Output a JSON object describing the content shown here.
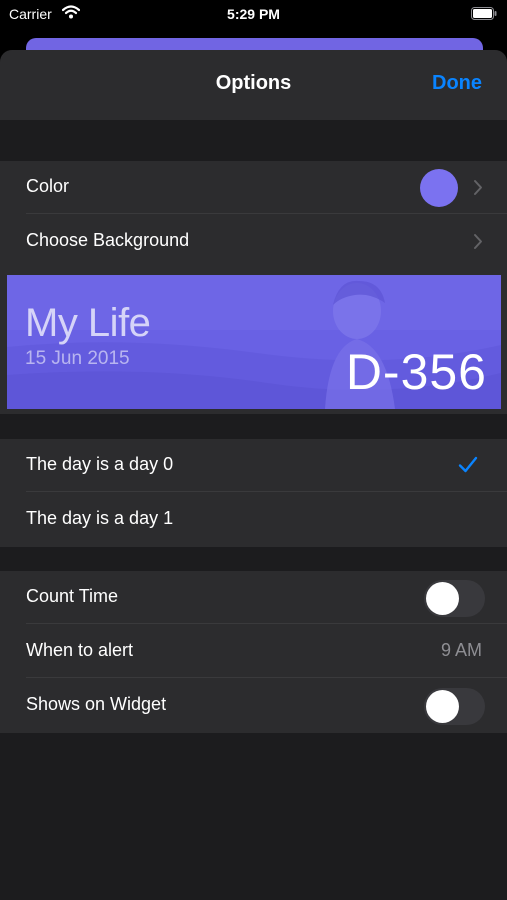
{
  "status_bar": {
    "carrier": "Carrier",
    "time": "5:29 PM",
    "icons": [
      "wifi-icon",
      "battery-icon"
    ]
  },
  "nav": {
    "title": "Options",
    "done_label": "Done"
  },
  "appearance": {
    "color_label": "Color",
    "color_value": "#7b72f0",
    "background_label": "Choose Background"
  },
  "preview": {
    "title": "My Life",
    "date": "15 Jun 2015",
    "count": "D-356",
    "accent": "#6a62e6"
  },
  "day_options": [
    {
      "label": "The day is a day 0",
      "selected": true
    },
    {
      "label": "The day is a day 1",
      "selected": false
    }
  ],
  "settings": {
    "count_time_label": "Count Time",
    "count_time_on": false,
    "alert_label": "When to alert",
    "alert_value": "9 AM",
    "widget_label": "Shows on Widget",
    "widget_on": false
  },
  "colors": {
    "accent_blue": "#0a84ff",
    "sheet_bg": "#1c1c1e",
    "cell_bg": "#2c2c2e"
  }
}
